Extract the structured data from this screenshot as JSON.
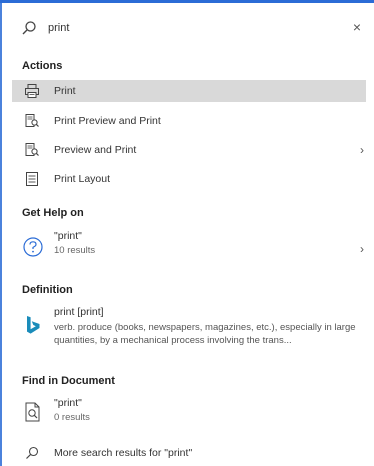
{
  "search": {
    "value": "print",
    "close_glyph": "×",
    "icon": "search-icon"
  },
  "sections": {
    "actions": "Actions",
    "help": "Get Help on",
    "definition": "Definition",
    "find": "Find in Document"
  },
  "actions": [
    {
      "label": "Print",
      "icon": "printer-icon",
      "highlighted": true
    },
    {
      "label": "Print Preview and Print",
      "icon": "print-preview-icon"
    },
    {
      "label": "Preview and Print",
      "icon": "preview-print-icon",
      "has_submenu": true
    },
    {
      "label": "Print Layout",
      "icon": "print-layout-icon"
    }
  ],
  "help": {
    "title": "\"print\"",
    "count": "10 results",
    "icon": "help-icon"
  },
  "definition": {
    "term": "print [print]",
    "text": "verb. produce (books, newspapers, magazines, etc.), especially in large quantities, by a mechanical process involving the trans...",
    "icon": "bing-icon"
  },
  "find": {
    "title": "\"print\"",
    "count": "0 results",
    "icon": "document-search-icon"
  },
  "more": {
    "label": "More search results for \"print\"",
    "icon": "search-icon"
  },
  "colors": {
    "accent": "#2b6cd6",
    "highlight": "#d9d9d9",
    "bing": "#1a8cba"
  },
  "chevron": "›"
}
